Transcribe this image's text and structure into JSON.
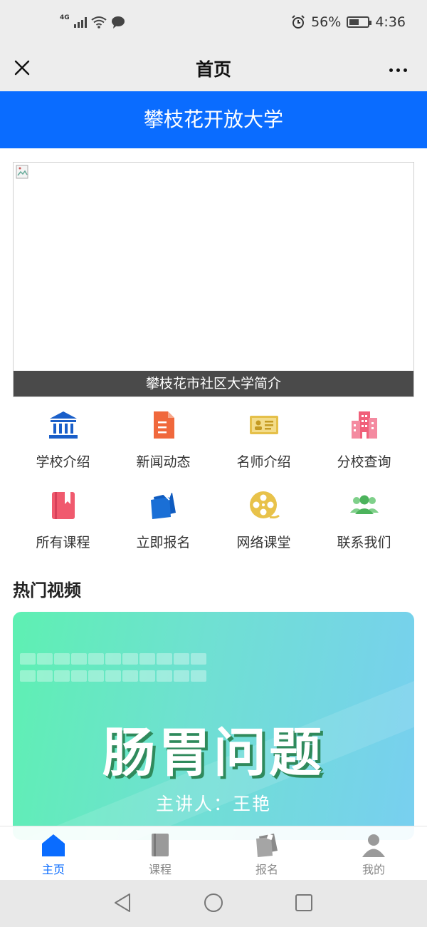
{
  "status_bar": {
    "network": "4G",
    "battery_percent": "56%",
    "battery_level": 0.56,
    "time": "4:36"
  },
  "nav": {
    "title": "首页"
  },
  "banner": {
    "title": "攀枝花开放大学"
  },
  "intro": {
    "caption": "攀枝花市社区大学简介"
  },
  "grid": [
    {
      "label": "学校介绍",
      "icon": "school-building-icon",
      "color": "#1a5fc9"
    },
    {
      "label": "新闻动态",
      "icon": "news-document-icon",
      "color": "#f0683c"
    },
    {
      "label": "名师介绍",
      "icon": "id-card-icon",
      "color": "#e5c04a"
    },
    {
      "label": "分校查询",
      "icon": "branch-buildings-icon",
      "color": "#f0607a"
    },
    {
      "label": "所有课程",
      "icon": "course-book-icon",
      "color": "#f05a6e"
    },
    {
      "label": "立即报名",
      "icon": "signup-note-icon",
      "color": "#1a6fd6"
    },
    {
      "label": "网络课堂",
      "icon": "film-reel-icon",
      "color": "#e8c24a"
    },
    {
      "label": "联系我们",
      "icon": "people-group-icon",
      "color": "#5cc06a"
    }
  ],
  "hot_videos": {
    "section_title": "热门视频",
    "items": [
      {
        "title": "肠胃问题",
        "speaker": "主讲人：王艳"
      }
    ]
  },
  "tabbar": [
    {
      "label": "主页",
      "icon": "home-icon",
      "active": true
    },
    {
      "label": "课程",
      "icon": "book-icon",
      "active": false
    },
    {
      "label": "报名",
      "icon": "signup-icon",
      "active": false
    },
    {
      "label": "我的",
      "icon": "user-icon",
      "active": false
    }
  ],
  "colors": {
    "accent": "#0a6cff",
    "tab_inactive": "#888888"
  }
}
